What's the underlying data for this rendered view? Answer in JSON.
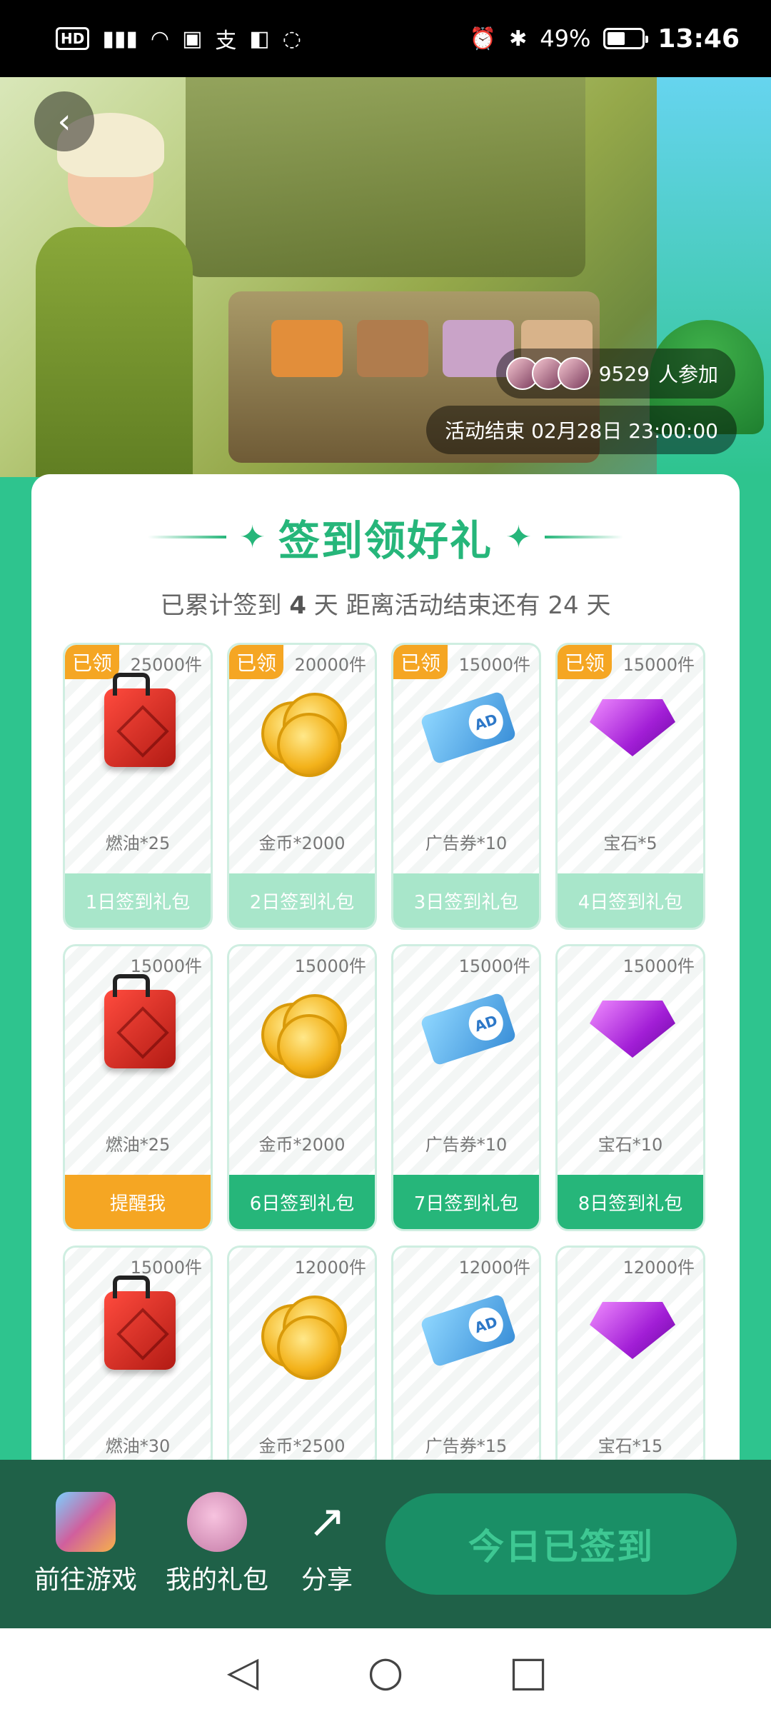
{
  "status_bar": {
    "left_icons": [
      "hd-icon",
      "5g-signal-icon",
      "wifi-icon",
      "notification-icon",
      "alipay-icon",
      "app-icon",
      "wechat-icon"
    ],
    "battery": "49%",
    "time": "13:46"
  },
  "banner": {
    "participants_count": "9529",
    "participants_suffix": "人参加",
    "end_time": "活动结束 02月28日 23:00:00"
  },
  "card": {
    "title": "签到领好礼",
    "subtitle_prefix": "已累计签到",
    "subtitle_days": "4",
    "subtitle_mid": "天  距离活动结束还有 24 天"
  },
  "gifts": [
    {
      "stock": "25000件",
      "name": "燃油*25",
      "button": "1日签到礼包",
      "badge": "已领",
      "state": "claimed",
      "icon": "fuel"
    },
    {
      "stock": "20000件",
      "name": "金币*2000",
      "button": "2日签到礼包",
      "badge": "已领",
      "state": "claimed",
      "icon": "coins"
    },
    {
      "stock": "15000件",
      "name": "广告券*10",
      "button": "3日签到礼包",
      "badge": "已领",
      "state": "claimed",
      "icon": "ticket"
    },
    {
      "stock": "15000件",
      "name": "宝石*5",
      "button": "4日签到礼包",
      "badge": "已领",
      "state": "claimed",
      "icon": "gem"
    },
    {
      "stock": "15000件",
      "name": "燃油*25",
      "button": "提醒我",
      "badge": "",
      "state": "remind",
      "icon": "fuel"
    },
    {
      "stock": "15000件",
      "name": "金币*2000",
      "button": "6日签到礼包",
      "badge": "",
      "state": "active",
      "icon": "coins"
    },
    {
      "stock": "15000件",
      "name": "广告券*10",
      "button": "7日签到礼包",
      "badge": "",
      "state": "active",
      "icon": "ticket"
    },
    {
      "stock": "15000件",
      "name": "宝石*10",
      "button": "8日签到礼包",
      "badge": "",
      "state": "active",
      "icon": "gem"
    },
    {
      "stock": "15000件",
      "name": "燃油*30",
      "button": "",
      "badge": "",
      "state": "none",
      "icon": "fuel"
    },
    {
      "stock": "12000件",
      "name": "金币*2500",
      "button": "",
      "badge": "",
      "state": "none",
      "icon": "coins"
    },
    {
      "stock": "12000件",
      "name": "广告券*15",
      "button": "",
      "badge": "",
      "state": "none",
      "icon": "ticket"
    },
    {
      "stock": "12000件",
      "name": "宝石*15",
      "button": "",
      "badge": "",
      "state": "none",
      "icon": "gem"
    }
  ],
  "ad_label": "AD",
  "bottom_bar": {
    "goto_game": "前往游戏",
    "my_gifts": "我的礼包",
    "share": "分享",
    "signed_button": "今日已签到"
  },
  "colors": {
    "primary": "#26b67a",
    "claimed": "#a8e6ca",
    "remind": "#f5a623",
    "bottom_bar": "#1f6148"
  }
}
